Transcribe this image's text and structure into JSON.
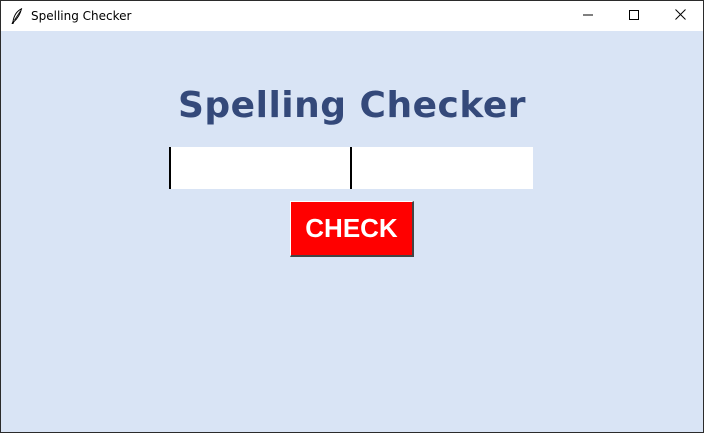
{
  "window": {
    "title": "Spelling Checker",
    "app_icon": "feather-icon",
    "controls": [
      "minimize-icon",
      "maximize-icon",
      "close-icon"
    ]
  },
  "main": {
    "heading": "Spelling Checker",
    "input_left": {
      "value": "",
      "placeholder": ""
    },
    "input_right": {
      "value": "",
      "placeholder": ""
    },
    "check_label": "CHECK"
  },
  "colors": {
    "background": "#d9e4f5",
    "heading": "#34497a",
    "button": "#ff0000",
    "button_text": "#ffffff"
  }
}
